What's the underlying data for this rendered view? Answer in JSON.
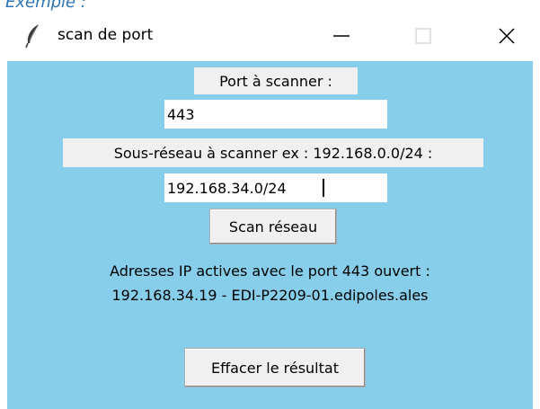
{
  "caption": "Exemple :",
  "window": {
    "title": "scan de port",
    "icon": "feather-icon",
    "controls": {
      "minimize_glyph": "—",
      "maximize_glyph": "☐",
      "close_glyph": "✕"
    }
  },
  "form": {
    "port_label": "Port à scanner :",
    "port_value": "443",
    "subnet_label": "Sous-réseau à scanner ex : 192.168.0.0/24 :",
    "subnet_value": "192.168.34.0/24",
    "scan_button": "Scan réseau",
    "clear_button": "Effacer le résultat"
  },
  "result": {
    "heading": "Adresses IP actives avec le port 443 ouvert :",
    "lines": [
      "192.168.34.19 - EDI-P2209-01.edipoles.ales"
    ]
  },
  "colors": {
    "background": "#87ceeb",
    "widget": "#f0f0f0",
    "caption": "#2e74b5"
  }
}
